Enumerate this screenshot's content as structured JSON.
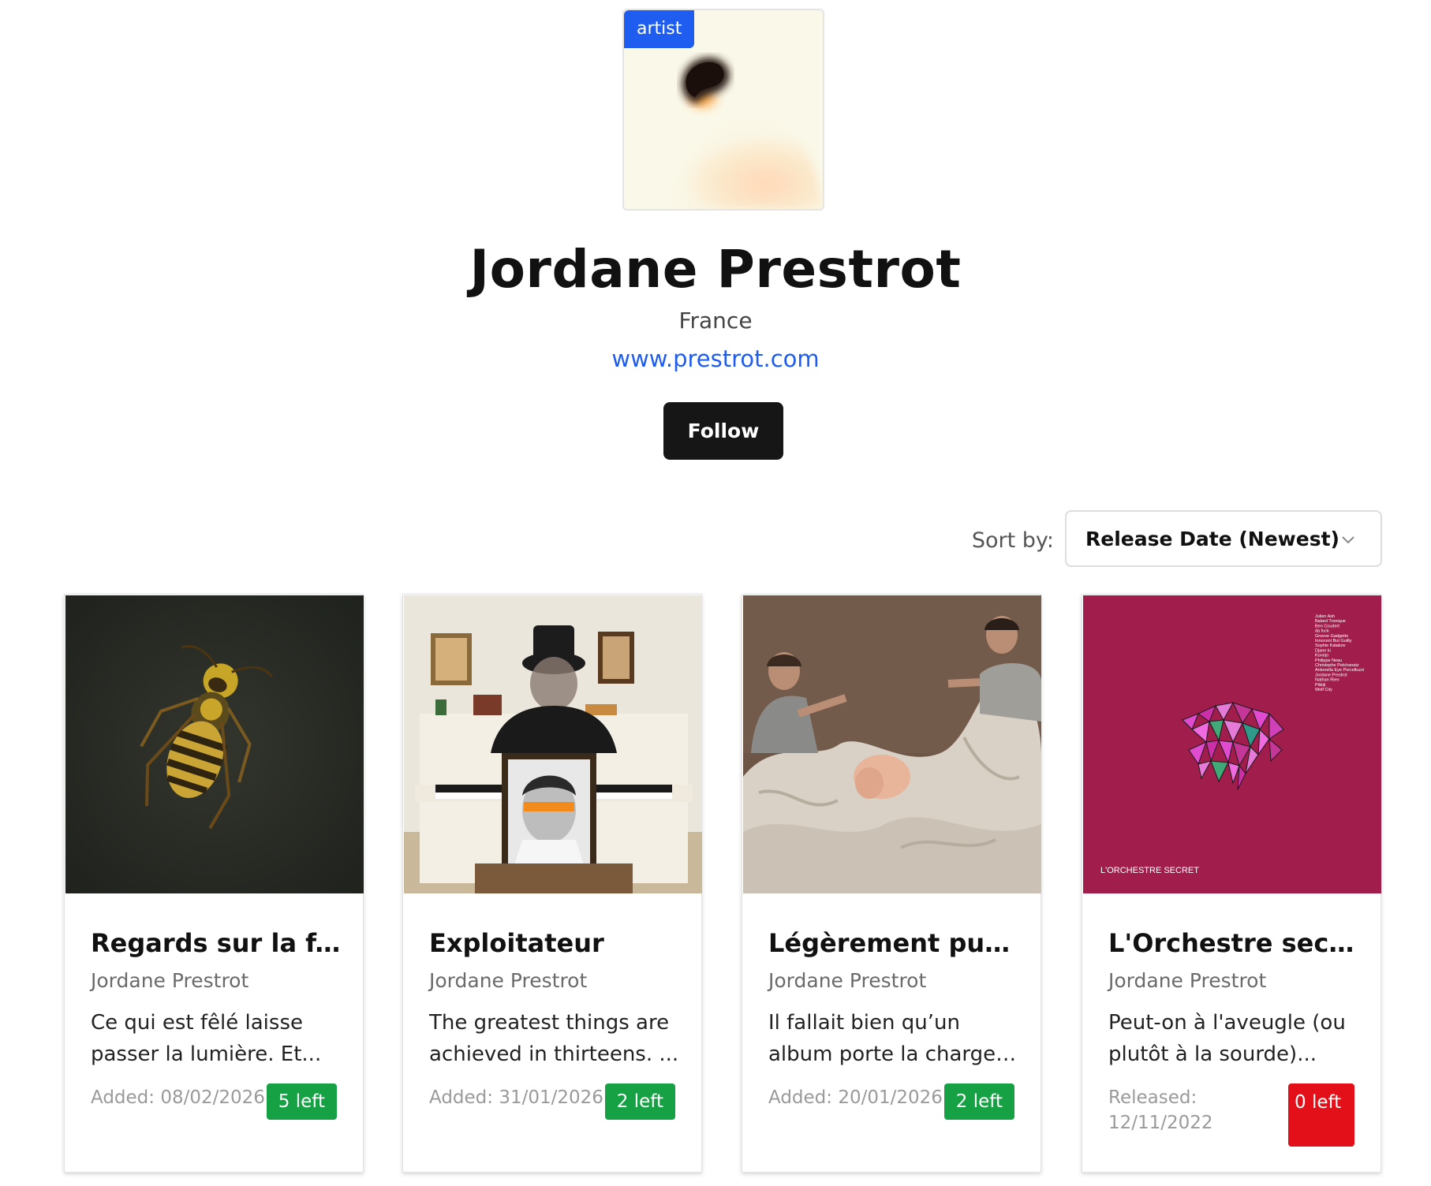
{
  "artist": {
    "badge": "artist",
    "name": "Jordane Prestrot",
    "country": "France",
    "website": "www.prestrot.com",
    "follow_label": "Follow"
  },
  "sort": {
    "label": "Sort by:",
    "selected": "Release Date (Newest)",
    "icon": "chevron-down-icon"
  },
  "albums": [
    {
      "title": "Regards sur la f...",
      "artist": "Jordane Prestrot",
      "description": "Ce qui est fêlé laisse passer la lumière. Et...",
      "date": "Added: 08/02/2026",
      "stock": "5 left",
      "stock_color": "#16a244"
    },
    {
      "title": "Exploitateur",
      "artist": "Jordane Prestrot",
      "description": "The greatest things are achieved in thirteens. ...",
      "date": "Added: 31/01/2026",
      "stock": "2 left",
      "stock_color": "#16a244"
    },
    {
      "title": "Légèrement put...",
      "artist": "Jordane Prestrot",
      "description": "Il fallait bien qu’un album porte la charge ...",
      "date": "Added: 20/01/2026",
      "stock": "2 left",
      "stock_color": "#16a244"
    },
    {
      "title": "L'Orchestre secret",
      "artist": "Jordane Prestrot",
      "description": "Peut-on à l'aveugle (ou plutôt à la sourde)...",
      "date": "Released: 12/11/2022",
      "stock": "0 left",
      "stock_color": "#e3101a",
      "cover_text": "L'ORCHESTRE SECRET",
      "cover_credits": [
        "Julien Ash",
        "Balard Tronique",
        "Ben Coudert",
        "da fuck",
        "Groove Gadgetto",
        "Innocent But Guilty",
        "Sophie Katakov",
        "Djane ki",
        "Konejo",
        "Philippe Neau",
        "Christophe Petchanatz",
        "Antonella Eye Porcelluzzi",
        "Jordane Prestrot",
        "Nathan Rien",
        "Pâkiji",
        "Wolf City"
      ]
    }
  ]
}
